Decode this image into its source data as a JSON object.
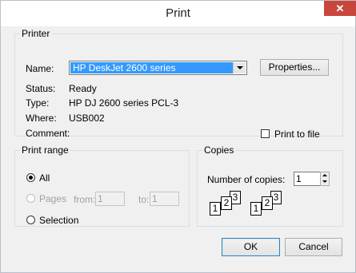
{
  "dialog": {
    "title": "Print",
    "close_glyph": "✕"
  },
  "printer": {
    "legend": "Printer",
    "name_label": "Name:",
    "name_value": "HP DeskJet 2600 series",
    "properties_label": "Properties...",
    "status_label": "Status:",
    "status_value": "Ready",
    "type_label": "Type:",
    "type_value": "HP DJ 2600 series PCL-3",
    "where_label": "Where:",
    "where_value": "USB002",
    "comment_label": "Comment:",
    "comment_value": "",
    "print_to_file_label": "Print to file",
    "print_to_file_checked": false
  },
  "print_range": {
    "legend": "Print range",
    "all_label": "All",
    "pages_label": "Pages",
    "from_label": "from:",
    "from_value": "1",
    "to_label": "to:",
    "to_value": "1",
    "selection_label": "Selection",
    "selected": "All"
  },
  "copies": {
    "legend": "Copies",
    "number_label": "Number of copies:",
    "number_value": "1",
    "collate_icon": "collate-pages-icon"
  },
  "buttons": {
    "ok_label": "OK",
    "cancel_label": "Cancel"
  }
}
